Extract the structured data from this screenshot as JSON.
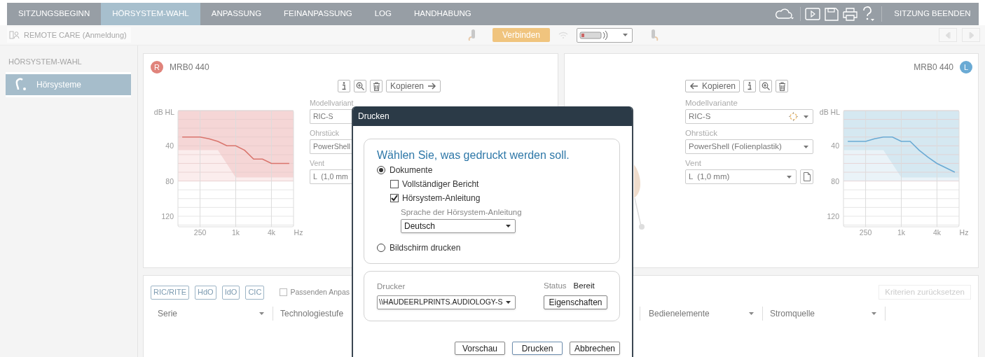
{
  "nav": {
    "tabs": [
      {
        "label": "SITZUNGSBEGINN",
        "selected": false
      },
      {
        "label": "HÖRSYSTEM-WAHL",
        "selected": true
      },
      {
        "label": "ANPASSUNG",
        "selected": false
      },
      {
        "label": "FEINANPASSUNG",
        "selected": false
      },
      {
        "label": "LOG",
        "selected": false
      },
      {
        "label": "HANDHABUNG",
        "selected": false
      }
    ],
    "end_session": "SITZUNG BEENDEN"
  },
  "toolbar": {
    "remote_care": "REMOTE CARE (Anmeldung)",
    "connect": "Verbinden"
  },
  "sidebar": {
    "heading": "HÖRSYSTEM-WAHL",
    "items": [
      {
        "label": "Hörsysteme",
        "selected": true
      }
    ]
  },
  "devices": [
    {
      "side": "R",
      "color": "#e0837b",
      "model": "MRB0 440",
      "copy": "Kopieren",
      "fields": [
        {
          "label": "Modellvariant",
          "value": "RIC-S"
        },
        {
          "label": "Ohrstück",
          "value": "PowerShell"
        },
        {
          "label": "Vent",
          "value": "L  (1,0 mm"
        }
      ],
      "chart_data": {
        "type": "line",
        "xlabel": "Hz",
        "ylabel": "dB HL",
        "categories": [
          null,
          null,
          "250",
          null,
          null,
          null,
          "1k",
          null,
          null,
          null,
          "4k",
          null,
          null
        ],
        "ylim": [
          132,
          0
        ],
        "yticks": [
          40,
          80,
          120
        ],
        "grid": true,
        "series": [
          {
            "color": "#d9756d",
            "values": [
              30,
              30,
              30,
              32,
              35,
              40,
              40,
              45,
              55,
              55,
              60,
              60,
              60
            ]
          }
        ]
      }
    },
    {
      "side": "L",
      "color": "#6aaad4",
      "model": "MRB0 440",
      "copy": "Kopieren",
      "fields": [
        {
          "label": "Modellvariante",
          "value": "RIC-S"
        },
        {
          "label": "Ohrstück",
          "value": "PowerShell (Folienplastik)"
        },
        {
          "label": "Vent",
          "value": "L  (1,0 mm)"
        }
      ],
      "chart_data": {
        "type": "line",
        "xlabel": "Hz",
        "ylabel": "dB HL",
        "categories": [
          null,
          null,
          "250",
          null,
          null,
          null,
          "1k",
          null,
          null,
          null,
          "4k",
          null,
          null
        ],
        "ylim": [
          132,
          0
        ],
        "yticks": [
          40,
          80,
          120
        ],
        "grid": true,
        "series": [
          {
            "color": "#6aaad4",
            "values": [
              35,
              35,
              35,
              32,
              30,
              30,
              35,
              35,
              45,
              53,
              60,
              65,
              70
            ]
          }
        ]
      }
    }
  ],
  "filter": {
    "types": [
      "RIC/RITE",
      "HdO",
      "IdO",
      "CIC"
    ],
    "checkbox": {
      "label": "Passenden Anpas",
      "checked": false
    },
    "reset": {
      "label": "Kriterien zurücksetzen",
      "disabled": true
    },
    "columns": [
      {
        "label": "Serie",
        "kind": "dropdown"
      },
      {
        "label": "Technologiestufe",
        "kind": "label"
      },
      {
        "label": "Bedienelemente",
        "kind": "dropdown"
      },
      {
        "label": "Stromquelle",
        "kind": "dropdown"
      }
    ]
  },
  "print_dialog": {
    "title": "Drucken",
    "heading": "Wählen Sie, was gedruckt werden soll.",
    "options": [
      {
        "label": "Dokumente",
        "selected": true
      },
      {
        "label": "Bildschirm drucken",
        "selected": false
      }
    ],
    "documents": [
      {
        "label": "Vollständiger Bericht",
        "checked": false
      },
      {
        "label": "Hörsystem-Anleitung",
        "checked": true
      }
    ],
    "language": {
      "label": "Sprache der Hörsystem-Anleitung",
      "value": "Deutsch"
    },
    "printer": {
      "label": "Drucker",
      "value": "\\\\HAUDEERLPRINTS.AUDIOLOGY-S",
      "status_label": "Status",
      "status": "Bereit",
      "properties": "Eigenschaften"
    },
    "buttons": [
      {
        "label": "Vorschau",
        "default": false
      },
      {
        "label": "Drucken",
        "default": true
      },
      {
        "label": "Abbrechen",
        "default": false
      }
    ]
  }
}
